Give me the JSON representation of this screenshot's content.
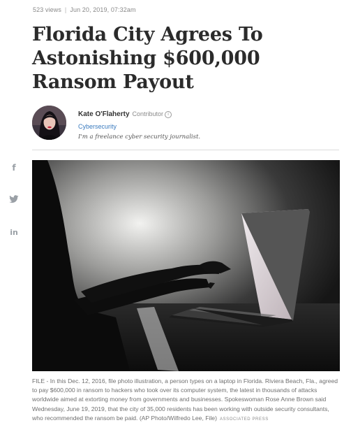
{
  "article": {
    "views": "523 views",
    "date": "Jun 20, 2019, 07:32am",
    "headline": "Florida City Agrees To Astonishing $600,000 Ransom Payout"
  },
  "author": {
    "name": "Kate O'Flaherty",
    "role": "Contributor",
    "info_glyph": "i",
    "channel": "Cybersecurity",
    "bio": "I'm a freelance cyber security journalist."
  },
  "share": {
    "items": [
      {
        "icon": "facebook-icon",
        "glyph": "f"
      },
      {
        "icon": "twitter-icon",
        "glyph": "t"
      },
      {
        "icon": "linkedin-icon",
        "glyph": "in"
      }
    ]
  },
  "photo": {
    "caption": "FILE - In this Dec. 12, 2016, file photo illustration, a person types on a laptop in Florida. Riviera Beach, Fla., agreed to pay $600,000 in ransom to hackers who took over its computer system, the latest in thousands of attacks worldwide aimed at extorting money from governments and businesses. Spokeswoman Rose Anne Brown said Wednesday, June 19, 2019, that the city of 35,000 residents has been working with outside security consultants, who recommended the ransom be paid. (AP Photo/Wilfredo Lee, File)",
    "source": "ASSOCIATED PRESS"
  },
  "colors": {
    "link": "#3b7bbf",
    "muted": "#8a8a8a",
    "headline": "#2b2b2b"
  }
}
